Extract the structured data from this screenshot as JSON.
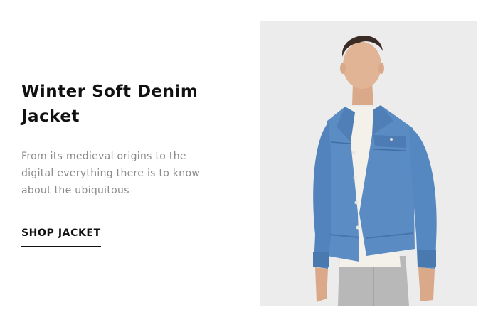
{
  "promo": {
    "title_line1": "Winter Soft Denim",
    "title_line2": "Jacket",
    "description_line1": "From its medieval origins to the",
    "description_line2": "digital everything there is to know",
    "description_line3": "about the ubiquitous",
    "cta_label": "SHOP JACKET"
  },
  "image": {
    "subject": "model-wearing-denim-jacket",
    "background_color": "#ececec",
    "jacket_color": "#5b8cc4"
  }
}
